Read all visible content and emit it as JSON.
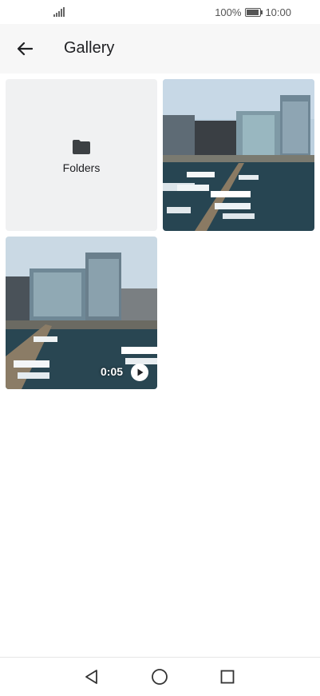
{
  "status_bar": {
    "battery": "100%",
    "time": "10:00"
  },
  "app_bar": {
    "title": "Gallery",
    "back_icon": "arrow-back-icon"
  },
  "grid": {
    "folders_tile": {
      "label": "Folders",
      "icon": "folder-icon"
    },
    "items": [
      {
        "type": "photo",
        "description": "marina-photo"
      },
      {
        "type": "video",
        "duration": "0:05",
        "icon": "play-icon"
      }
    ]
  },
  "nav_bar": {
    "icons": [
      "back-triangle-icon",
      "home-circle-icon",
      "recents-square-icon"
    ]
  },
  "colors": {
    "app_bar_bg": "#f7f7f7",
    "tile_bg": "#f0f1f2",
    "text": "#202124"
  }
}
